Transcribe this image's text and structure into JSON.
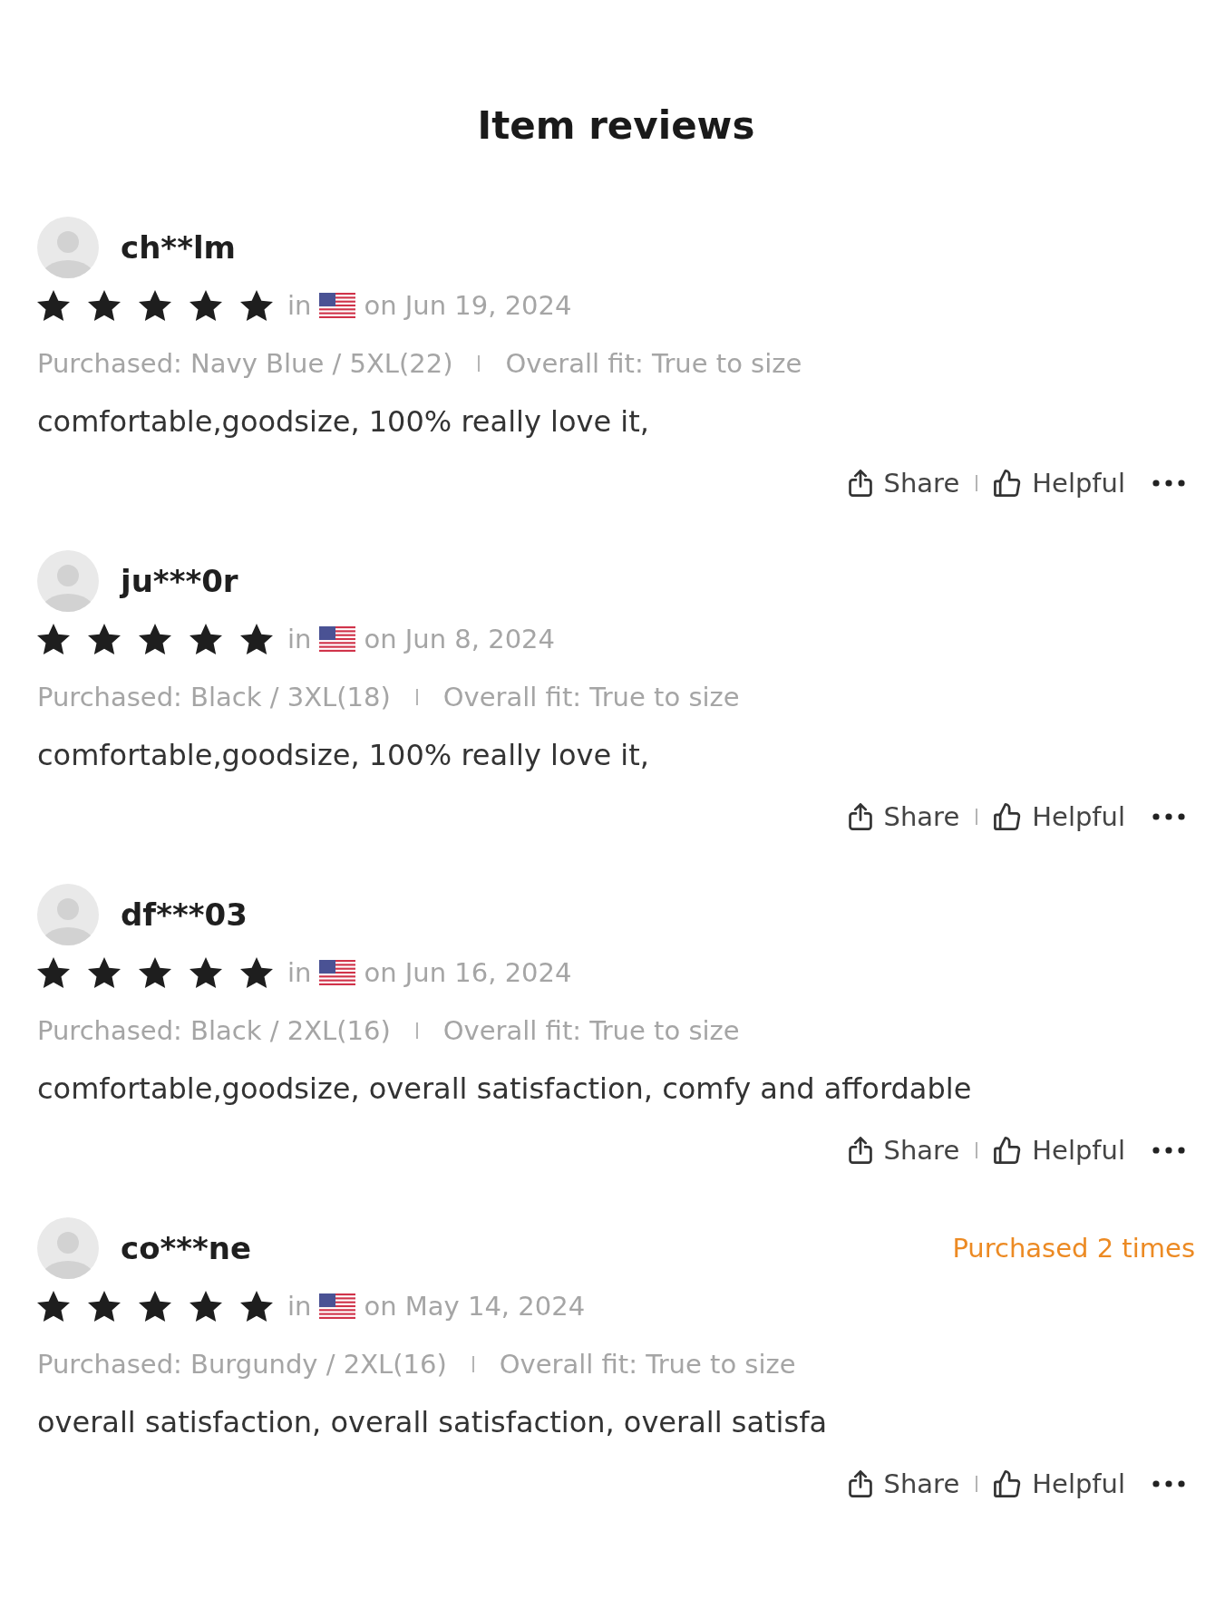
{
  "title": "Item reviews",
  "reviews": [
    {
      "user": "ch**lm",
      "stars": 5,
      "location_prefix": "in",
      "date": "on Jun 19, 2024",
      "purchased": "Purchased: Navy Blue / 5XL(22)",
      "fit": "Overall fit: True to size",
      "comment": "comfortable,goodsize, 100% really love it,",
      "share": "Share",
      "helpful": "Helpful"
    },
    {
      "user": "ju***0r",
      "stars": 5,
      "location_prefix": "in",
      "date": "on Jun 8, 2024",
      "purchased": "Purchased: Black / 3XL(18)",
      "fit": "Overall fit: True to size",
      "comment": "comfortable,goodsize, 100% really love it,",
      "share": "Share",
      "helpful": "Helpful"
    },
    {
      "user": "df***03",
      "stars": 5,
      "location_prefix": "in",
      "date": "on Jun 16, 2024",
      "purchased": "Purchased: Black / 2XL(16)",
      "fit": "Overall fit: True to size",
      "comment": "comfortable,goodsize, overall satisfaction, comfy and affordable",
      "share": "Share",
      "helpful": "Helpful"
    },
    {
      "user": "co***ne",
      "badge": "Purchased 2 times",
      "stars": 5,
      "location_prefix": "in",
      "date": "on May 14, 2024",
      "purchased": "Purchased: Burgundy / 2XL(16)",
      "fit": "Overall fit: True to size",
      "comment": "overall satisfaction, overall satisfaction, overall satisfa",
      "share": "Share",
      "helpful": "Helpful"
    }
  ]
}
